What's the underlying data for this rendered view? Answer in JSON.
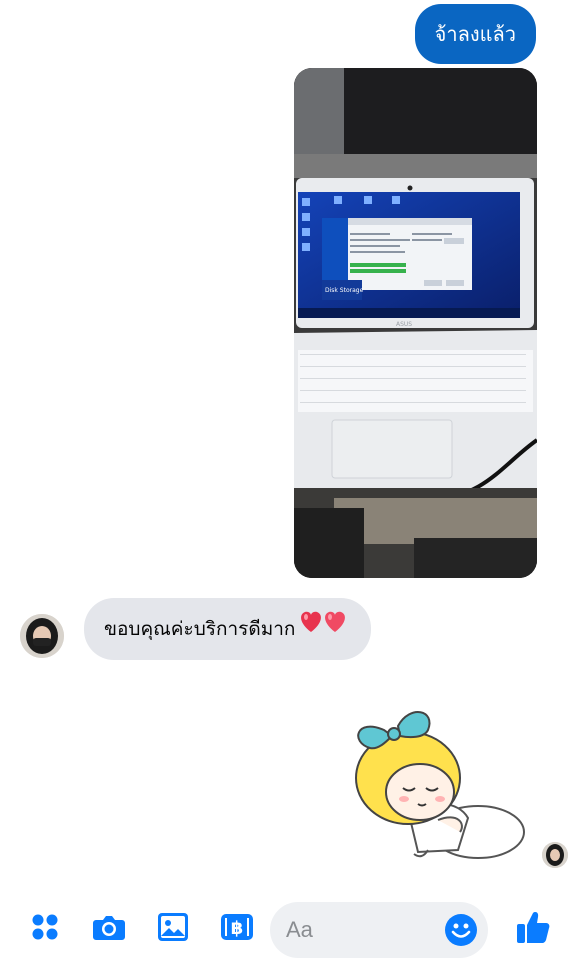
{
  "conversation": {
    "messages": [
      {
        "direction": "outgoing",
        "type": "text",
        "text": "จ้าลงแล้ว"
      },
      {
        "direction": "outgoing",
        "type": "photo",
        "photo": {
          "subject": "laptop",
          "laptop_brand_text": "ASUS",
          "screen_caption": "Disk Storage"
        }
      },
      {
        "direction": "incoming",
        "type": "text",
        "text": "ขอบคุณค่ะบริการดีมาก",
        "emoji": "two-hearts"
      },
      {
        "direction": "incoming",
        "type": "sticker",
        "sticker": "girl-hugging-pillow"
      }
    ]
  },
  "composer": {
    "placeholder": "Aa",
    "tools": [
      "grid-menu-icon",
      "camera-icon",
      "image-icon",
      "baht-payment-icon"
    ],
    "emoji_icon": "smiley-emoji-icon",
    "send_icon": "thumbs-up-icon"
  },
  "colors": {
    "accent": "#0a66c2",
    "incoming_bubble": "#e4e6eb",
    "composer_input": "#eef0f3",
    "icon_blue": "#0a7cff"
  }
}
